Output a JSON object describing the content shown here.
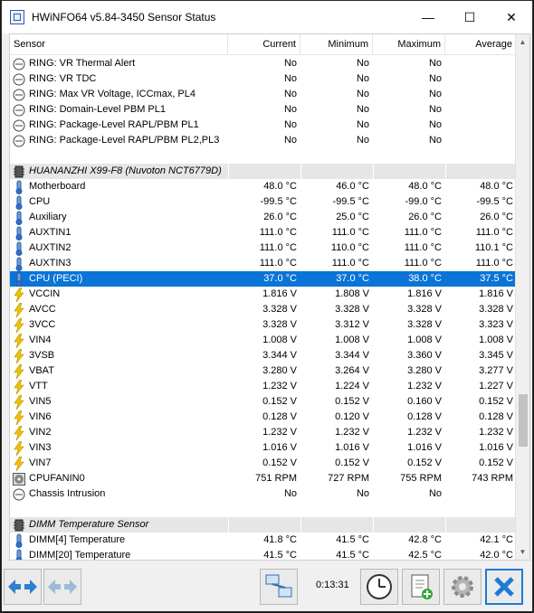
{
  "window": {
    "title": "HWiNFO64 v5.84-3450 Sensor Status"
  },
  "titlebar_buttons": {
    "minimize": "—",
    "maximize": "☐",
    "close": "✕"
  },
  "columns": [
    "Sensor",
    "Current",
    "Minimum",
    "Maximum",
    "Average"
  ],
  "rows": [
    {
      "icon": "clock-sensor-icon",
      "label": "RING: VR Thermal Alert",
      "cur": "No",
      "min": "No",
      "max": "No",
      "avg": ""
    },
    {
      "icon": "clock-sensor-icon",
      "label": "RING: VR TDC",
      "cur": "No",
      "min": "No",
      "max": "No",
      "avg": ""
    },
    {
      "icon": "clock-sensor-icon",
      "label": "RING: Max VR Voltage, ICCmax, PL4",
      "cur": "No",
      "min": "No",
      "max": "No",
      "avg": ""
    },
    {
      "icon": "clock-sensor-icon",
      "label": "RING: Domain-Level PBM PL1",
      "cur": "No",
      "min": "No",
      "max": "No",
      "avg": ""
    },
    {
      "icon": "clock-sensor-icon",
      "label": "RING: Package-Level RAPL/PBM PL1",
      "cur": "No",
      "min": "No",
      "max": "No",
      "avg": ""
    },
    {
      "icon": "clock-sensor-icon",
      "label": "RING: Package-Level RAPL/PBM PL2,PL3",
      "cur": "No",
      "min": "No",
      "max": "No",
      "avg": ""
    },
    {
      "type": "blank"
    },
    {
      "type": "group",
      "icon": "chip-icon",
      "label": "HUANANZHI X99-F8 (Nuvoton NCT6779D)"
    },
    {
      "icon": "thermometer-icon",
      "label": "Motherboard",
      "cur": "48.0 °C",
      "min": "46.0 °C",
      "max": "48.0 °C",
      "avg": "48.0 °C"
    },
    {
      "icon": "thermometer-icon",
      "label": "CPU",
      "cur": "-99.5 °C",
      "min": "-99.5 °C",
      "max": "-99.0 °C",
      "avg": "-99.5 °C"
    },
    {
      "icon": "thermometer-icon",
      "label": "Auxiliary",
      "cur": "26.0 °C",
      "min": "25.0 °C",
      "max": "26.0 °C",
      "avg": "26.0 °C"
    },
    {
      "icon": "thermometer-icon",
      "label": "AUXTIN1",
      "cur": "111.0 °C",
      "min": "111.0 °C",
      "max": "111.0 °C",
      "avg": "111.0 °C"
    },
    {
      "icon": "thermometer-icon",
      "label": "AUXTIN2",
      "cur": "111.0 °C",
      "min": "110.0 °C",
      "max": "111.0 °C",
      "avg": "110.1 °C"
    },
    {
      "icon": "thermometer-icon",
      "label": "AUXTIN3",
      "cur": "111.0 °C",
      "min": "111.0 °C",
      "max": "111.0 °C",
      "avg": "111.0 °C"
    },
    {
      "icon": "thermometer-icon",
      "label": "CPU (PECI)",
      "cur": "37.0 °C",
      "min": "37.0 °C",
      "max": "38.0 °C",
      "avg": "37.5 °C",
      "selected": true
    },
    {
      "icon": "lightning-icon",
      "label": "VCCIN",
      "cur": "1.816 V",
      "min": "1.808 V",
      "max": "1.816 V",
      "avg": "1.816 V"
    },
    {
      "icon": "lightning-icon",
      "label": "AVCC",
      "cur": "3.328 V",
      "min": "3.328 V",
      "max": "3.328 V",
      "avg": "3.328 V"
    },
    {
      "icon": "lightning-icon",
      "label": "3VCC",
      "cur": "3.328 V",
      "min": "3.312 V",
      "max": "3.328 V",
      "avg": "3.323 V"
    },
    {
      "icon": "lightning-icon",
      "label": "VIN4",
      "cur": "1.008 V",
      "min": "1.008 V",
      "max": "1.008 V",
      "avg": "1.008 V"
    },
    {
      "icon": "lightning-icon",
      "label": "3VSB",
      "cur": "3.344 V",
      "min": "3.344 V",
      "max": "3.360 V",
      "avg": "3.345 V"
    },
    {
      "icon": "lightning-icon",
      "label": "VBAT",
      "cur": "3.280 V",
      "min": "3.264 V",
      "max": "3.280 V",
      "avg": "3.277 V"
    },
    {
      "icon": "lightning-icon",
      "label": "VTT",
      "cur": "1.232 V",
      "min": "1.224 V",
      "max": "1.232 V",
      "avg": "1.227 V"
    },
    {
      "icon": "lightning-icon",
      "label": "VIN5",
      "cur": "0.152 V",
      "min": "0.152 V",
      "max": "0.160 V",
      "avg": "0.152 V"
    },
    {
      "icon": "lightning-icon",
      "label": "VIN6",
      "cur": "0.128 V",
      "min": "0.120 V",
      "max": "0.128 V",
      "avg": "0.128 V"
    },
    {
      "icon": "lightning-icon",
      "label": "VIN2",
      "cur": "1.232 V",
      "min": "1.232 V",
      "max": "1.232 V",
      "avg": "1.232 V"
    },
    {
      "icon": "lightning-icon",
      "label": "VIN3",
      "cur": "1.016 V",
      "min": "1.016 V",
      "max": "1.016 V",
      "avg": "1.016 V"
    },
    {
      "icon": "lightning-icon",
      "label": "VIN7",
      "cur": "0.152 V",
      "min": "0.152 V",
      "max": "0.152 V",
      "avg": "0.152 V"
    },
    {
      "icon": "fan-icon",
      "label": "CPUFANIN0",
      "cur": "751 RPM",
      "min": "727 RPM",
      "max": "755 RPM",
      "avg": "743 RPM"
    },
    {
      "icon": "clock-sensor-icon",
      "label": "Chassis Intrusion",
      "cur": "No",
      "min": "No",
      "max": "No",
      "avg": ""
    },
    {
      "type": "blank"
    },
    {
      "type": "group",
      "icon": "chip-icon",
      "label": "DIMM Temperature Sensor"
    },
    {
      "icon": "thermometer-icon",
      "label": "DIMM[4] Temperature",
      "cur": "41.8 °C",
      "min": "41.5 °C",
      "max": "42.8 °C",
      "avg": "42.1 °C"
    },
    {
      "icon": "thermometer-icon",
      "label": "DIMM[20] Temperature",
      "cur": "41.5 °C",
      "min": "41.5 °C",
      "max": "42.5 °C",
      "avg": "42.0 °C"
    }
  ],
  "timer": "0:13:31",
  "colors": {
    "selection": "#0a74d7",
    "group_bg": "#e6e6e6",
    "close_button": "#1d7bd6"
  }
}
